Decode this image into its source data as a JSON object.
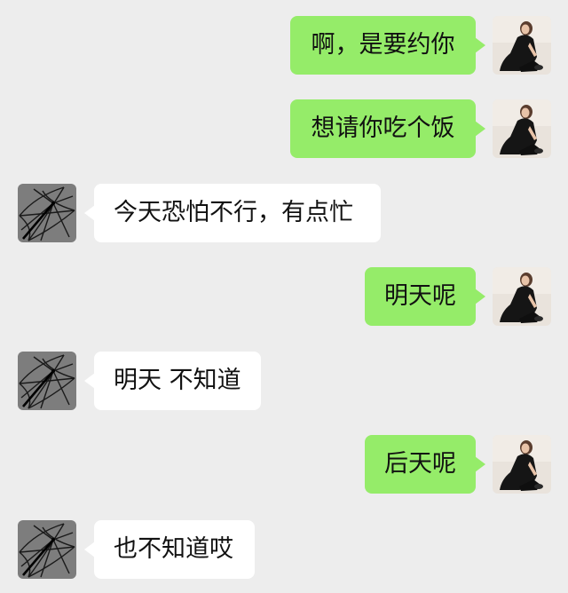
{
  "conversation": {
    "messages": [
      {
        "sender": "self",
        "text": "啊，是要约你"
      },
      {
        "sender": "self",
        "text": "想请你吃个饭"
      },
      {
        "sender": "other",
        "text": "今天恐怕不行，有点忙"
      },
      {
        "sender": "self",
        "text": "明天呢"
      },
      {
        "sender": "other",
        "text": "明天 不知道"
      },
      {
        "sender": "self",
        "text": "后天呢"
      },
      {
        "sender": "other",
        "text": "也不知道哎"
      }
    ]
  },
  "colors": {
    "background": "#ededed",
    "self_bubble": "#95ec69",
    "other_bubble": "#ffffff",
    "text": "#111111"
  },
  "icons": {
    "self_avatar": "woman-black-dress-photo",
    "other_avatar": "umbrella-photo"
  }
}
